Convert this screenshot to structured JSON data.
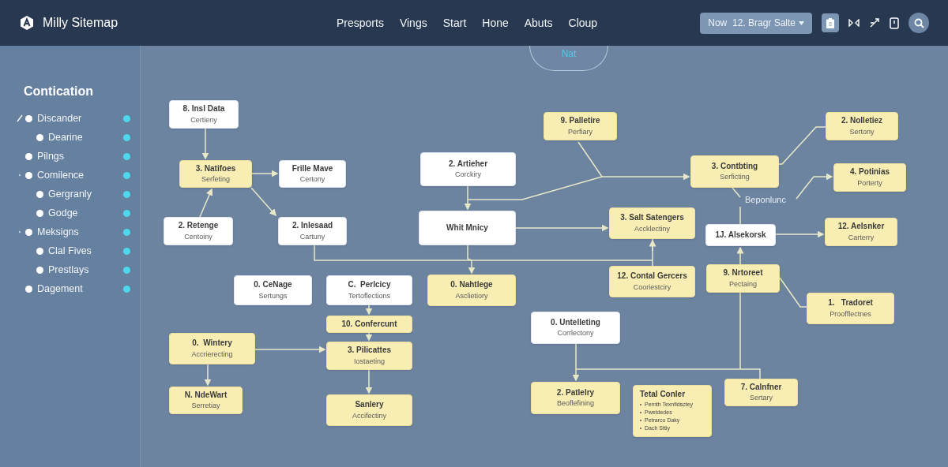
{
  "app": {
    "title": "Milly Sitemap"
  },
  "nav": [
    "Presports",
    "Vings",
    "Start",
    "Hone",
    "Abuts",
    "Cloup"
  ],
  "view_select": {
    "value": "Now  12. Bragr Salte"
  },
  "center_tab": {
    "label": "Nat"
  },
  "sidebar": {
    "title": "Contication",
    "items": [
      {
        "label": "Discander",
        "editing": true,
        "children": [
          {
            "label": "Dearine",
            "editing": false
          }
        ]
      },
      {
        "label": "Pilngs",
        "editing": false
      },
      {
        "label": "Comilence",
        "editing": false,
        "children": [
          {
            "label": "Gergranly",
            "editing": false
          },
          {
            "label": "Godge",
            "editing": false
          }
        ]
      },
      {
        "label": "Meksigns",
        "editing": false,
        "children": [
          {
            "label": "Clal Fives",
            "editing": false
          },
          {
            "label": "Prestlays",
            "editing": false
          }
        ]
      },
      {
        "label": "Dagement",
        "editing": false
      }
    ]
  },
  "diagram": {
    "label": "Beponlunc",
    "nodes": [
      {
        "kind": "white",
        "title": "8. Insl Data",
        "subtitle": "Certieny"
      },
      {
        "kind": "yellow",
        "title": "3. Natifoes",
        "subtitle": "Serfeting"
      },
      {
        "kind": "white",
        "title": "Frille Mave",
        "subtitle": "Certony"
      },
      {
        "kind": "white",
        "title": "2. Retenge",
        "subtitle": "Centoiny"
      },
      {
        "kind": "white",
        "title": "2. Inlesaad",
        "subtitle": "Cartuny"
      },
      {
        "kind": "white",
        "title": "2. Artieher",
        "subtitle": "Corckiry"
      },
      {
        "kind": "white",
        "title": "Whit Mnicy"
      },
      {
        "kind": "yellow",
        "title": "9. Palletire",
        "subtitle": "Perfiary"
      },
      {
        "kind": "yellow",
        "title": "3. Salt Satengers",
        "subtitle": "Accklectiny"
      },
      {
        "kind": "yellow",
        "title": "12. Contal Gercers",
        "subtitle": "Cooriestciry"
      },
      {
        "kind": "yellow",
        "title": "3. Contbting",
        "subtitle": "Serficting"
      },
      {
        "kind": "yellow",
        "title": "2. Nolletiez",
        "subtitle": "Sertony"
      },
      {
        "kind": "yellow",
        "title": "4. Potinias",
        "subtitle": "Porterty"
      },
      {
        "kind": "white",
        "title": "1J. Alsekorsk"
      },
      {
        "kind": "yellow",
        "title": "12. Aelsnker",
        "subtitle": "Carterry"
      },
      {
        "kind": "yellow",
        "title": "9. Nrtoreet",
        "subtitle": "Pectaing"
      },
      {
        "kind": "yellow",
        "title": "1.   Tradoret",
        "subtitle": "Proofflectnes"
      },
      {
        "kind": "white",
        "title": "0. CeNage",
        "subtitle": "Sertungs"
      },
      {
        "kind": "white",
        "title": "C.  Perlcicy",
        "subtitle": "Tertoflections"
      },
      {
        "kind": "yellow",
        "title": "0. Nahtlege",
        "subtitle": "Asclietiory"
      },
      {
        "kind": "yellow",
        "title": "10. Confercunt"
      },
      {
        "kind": "yellow",
        "title": "3. Pilicattes",
        "subtitle": "Iostaeting"
      },
      {
        "kind": "yellow",
        "title": "0.  Wintery",
        "subtitle": "Accrierecting"
      },
      {
        "kind": "yellow",
        "title": "N. NdeWart",
        "subtitle": "Serretiay"
      },
      {
        "kind": "yellow",
        "title": "Sanlery",
        "subtitle": "Accifectiny"
      },
      {
        "kind": "white",
        "title": "0. Untelleting",
        "subtitle": "Corrlectony"
      },
      {
        "kind": "yellow",
        "title": "2. Patlelry",
        "subtitle": "Beoflefining"
      },
      {
        "kind": "yellow",
        "title": "Tetal Conler",
        "bullets": [
          "Pernth Texnfidsctey",
          "Pwetdedes",
          "Petrarco Daky",
          "Dach Sttiy"
        ]
      },
      {
        "kind": "yellow",
        "title": "7. Calnfner",
        "subtitle": "Sertary"
      }
    ]
  }
}
